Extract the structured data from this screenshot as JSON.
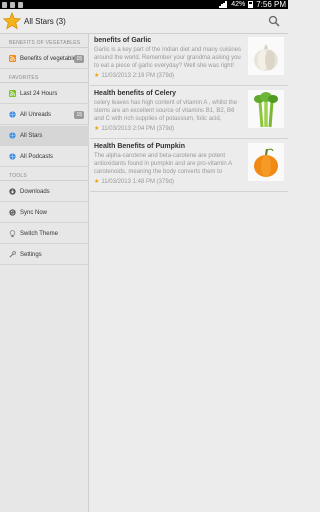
{
  "status": {
    "battery_pct": "42%",
    "time": "7:56 PM"
  },
  "actionbar": {
    "title": "All Stars (3)",
    "search_icon": "search-icon",
    "app_icon": "star-icon",
    "accent": "#f5b21a"
  },
  "sidebar": {
    "section_feeds": "BENEFITS OF VEGETABLES",
    "feed": {
      "label": "Benefits of vegetables",
      "count": "15",
      "icon": "rss-icon"
    },
    "section_favorites": "FAVORITES",
    "favorites": [
      {
        "label": "Last 24 Hours",
        "icon": "rss-icon",
        "count": ""
      },
      {
        "label": "All Unreads",
        "icon": "globe-icon",
        "count": "15"
      },
      {
        "label": "All Stars",
        "icon": "globe-icon",
        "count": ""
      },
      {
        "label": "All Podcasts",
        "icon": "globe-icon",
        "count": ""
      }
    ],
    "section_tools": "TOOLS",
    "tools": [
      {
        "label": "Downloads",
        "icon": "download-icon"
      },
      {
        "label": "Sync Now",
        "icon": "sync-icon"
      },
      {
        "label": "Switch Theme",
        "icon": "lightbulb-icon"
      },
      {
        "label": "Settings",
        "icon": "wrench-icon"
      }
    ]
  },
  "articles": [
    {
      "title": "benefits of Garlic",
      "excerpt": "Garlic is a key part of the Indian diet and many cuisines around the world.  Remember your grandma asking you to eat a piece of garlic everyday? Well she was right!",
      "meta": "11/03/2013 2:19 PM (379d)",
      "thumb": "garlic-image"
    },
    {
      "title": "Health benefits of Celery",
      "excerpt": "celery leaves has high content of  vitamin A , whilst the stems are an excellent source of vitamins  B1, B2, B6 and C  with rich supplies of  potassium, folic acid,",
      "meta": "11/03/2013 2:04 PM (379d)",
      "thumb": "celery-image"
    },
    {
      "title": "Health Benefits of Pumpkin",
      "excerpt": "The alpha-carotene and beta-carotene are potent antioxidants found in pumpkin and are pro-vitamin A carotenoids, meaning the body converts them to",
      "meta": "11/03/2013 1:48 PM (379d)",
      "thumb": "pumpkin-image"
    }
  ]
}
